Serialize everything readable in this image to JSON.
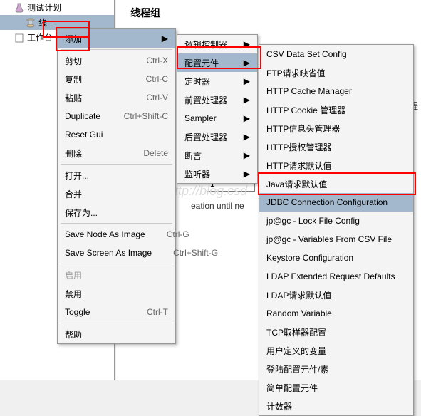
{
  "tree": {
    "root": "测试计划",
    "node1": "线",
    "node2": "工作台"
  },
  "main": {
    "title": "线程组",
    "bgname_partial": "程",
    "creation_partial": "eation until ne",
    "spinner_value": "1"
  },
  "watermark": "http://blog.csd",
  "menu1": {
    "add": "添加",
    "cut": "剪切",
    "cut_sc": "Ctrl-X",
    "copy": "复制",
    "copy_sc": "Ctrl-C",
    "paste": "粘贴",
    "paste_sc": "Ctrl-V",
    "duplicate": "Duplicate",
    "dup_sc": "Ctrl+Shift-C",
    "reset": "Reset Gui",
    "delete": "删除",
    "delete_sc": "Delete",
    "open": "打开...",
    "merge": "合并",
    "saveas": "保存为...",
    "savenode": "Save Node As Image",
    "savenode_sc": "Ctrl-G",
    "savescreen": "Save Screen As Image",
    "savescreen_sc": "Ctrl+Shift-G",
    "enable": "启用",
    "disable": "禁用",
    "toggle": "Toggle",
    "toggle_sc": "Ctrl-T",
    "help": "帮助"
  },
  "menu2": {
    "logic": "逻辑控制器",
    "config": "配置元件",
    "timer": "定时器",
    "pre": "前置处理器",
    "sampler": "Sampler",
    "post": "后置处理器",
    "assert": "断言",
    "listener": "监听器"
  },
  "menu3": {
    "csv": "CSV Data Set Config",
    "ftp": "FTP请求缺省值",
    "cache": "HTTP Cache Manager",
    "cookie": "HTTP Cookie 管理器",
    "header": "HTTP信息头管理器",
    "auth": "HTTP授权管理器",
    "httpdef": "HTTP请求默认值",
    "javadef": "Java请求默认值",
    "jdbc": "JDBC Connection Configuration",
    "lock": "jp@gc - Lock File Config",
    "varscsv": "jp@gc - Variables From CSV File",
    "keystore": "Keystore Configuration",
    "ldapext": "LDAP Extended Request Defaults",
    "ldapdef": "LDAP请求默认值",
    "random": "Random Variable",
    "tcp": "TCP取样器配置",
    "uservar": "用户定义的变量",
    "login": "登陆配置元件/素",
    "simple": "简单配置元件",
    "counter": "计数器"
  }
}
